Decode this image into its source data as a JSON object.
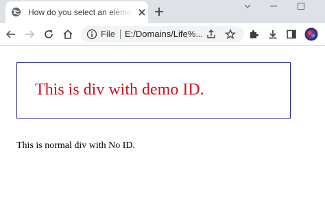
{
  "browser": {
    "tab": {
      "title": "How do you select an element with ID",
      "favicon": "globe-icon",
      "close_icon": "close-icon"
    },
    "new_tab_icon": "plus-icon",
    "window_controls": [
      "chevron-down-icon",
      "minimize-icon",
      "maximize-icon"
    ],
    "toolbar": {
      "back_icon": "back-arrow-icon",
      "forward_icon": "forward-arrow-icon",
      "reload_icon": "reload-icon",
      "home_icon": "home-icon",
      "address": {
        "info_icon": "info-icon",
        "scheme": "File",
        "url": "E:/Domains/Life%...",
        "share_icon": "share-icon",
        "bookmark_icon": "star-icon"
      },
      "extensions_icon": "puzzle-icon",
      "download_icon": "download-icon",
      "sidepanel_icon": "side-panel-icon",
      "profile_icon": "profile-avatar-icon"
    }
  },
  "page": {
    "demo_div_text": "This is div with demo ID.",
    "normal_div_text": "This is normal div with No ID."
  },
  "colors": {
    "demo_text": "#d0101a",
    "demo_border": "#1f1f8f",
    "tabstrip_bg": "#dee1e6"
  }
}
